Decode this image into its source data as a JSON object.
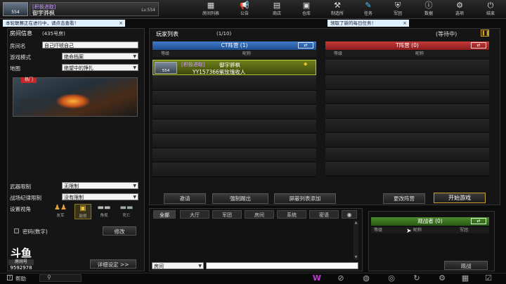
{
  "player": {
    "clan": "[积极进取]",
    "name": "御宇骅枫",
    "level": "Lv.554",
    "avatar_level": "554"
  },
  "nav": [
    {
      "label": "房间列表",
      "icon": "room-list-icon"
    },
    {
      "label": "公告",
      "icon": "megaphone-icon"
    },
    {
      "label": "商店",
      "icon": "shop-icon"
    },
    {
      "label": "仓库",
      "icon": "warehouse-icon"
    },
    {
      "label": "制造所",
      "icon": "factory-icon"
    },
    {
      "label": "任务",
      "icon": "mission-icon"
    },
    {
      "label": "军团",
      "icon": "clan-icon"
    },
    {
      "label": "数据",
      "icon": "data-icon"
    },
    {
      "label": "选项",
      "icon": "gear-icon"
    },
    {
      "label": "结束",
      "icon": "power-icon"
    }
  ],
  "notices": {
    "left": "本轮联赛正在进行中，请点击查看！",
    "right": "领取了新的每日任务！"
  },
  "room": {
    "title": "房间信息",
    "room_no": "(435号房)",
    "name_label": "房间名",
    "name_value": "自己吓唬自己",
    "mode_label": "游戏模式",
    "mode_value": "绝命档案",
    "map_label": "地图",
    "map_value": "绝望中的挣扎",
    "hot_badge": "热门",
    "weapon_label": "武器限制",
    "weapon_value": "无限制",
    "discipline_label": "战场纪律限制",
    "discipline_value": "没有限制",
    "view_label": "设置视角",
    "views": [
      "友军",
      "敌视",
      "角视",
      "死亡"
    ],
    "password_label": "密码(数字)",
    "edit_btn": "修改",
    "detail_btn": "详细设定 >>"
  },
  "players": {
    "title": "玩家列表",
    "count": "(1/10)",
    "status": "(等待中)",
    "ct_header": "CT阵营 (1)",
    "t_header": "T阵营 (0)",
    "col_level": "等级",
    "col_name": "昵称",
    "ct_player": {
      "clan": "[积极进取]",
      "name": "御宇骅枫",
      "subtitle": "YY157366紫玫瑰收人",
      "level": "554"
    }
  },
  "actions": {
    "invite": "邀请",
    "kick": "强制踢出",
    "block": "屏蔽列表添加",
    "change_team": "更改阵营",
    "start": "开始游戏"
  },
  "chat": {
    "tabs": [
      "全部",
      "大厅",
      "军团",
      "房间",
      "系统",
      "密语"
    ],
    "channel": "房间"
  },
  "spectator": {
    "header": "观战者 (0)",
    "col_level": "等级",
    "col_name": "昵称",
    "col_clan": "军团",
    "btn": "观战"
  },
  "logo": {
    "text": "房间号",
    "id": "9592978"
  },
  "help": "帮助"
}
